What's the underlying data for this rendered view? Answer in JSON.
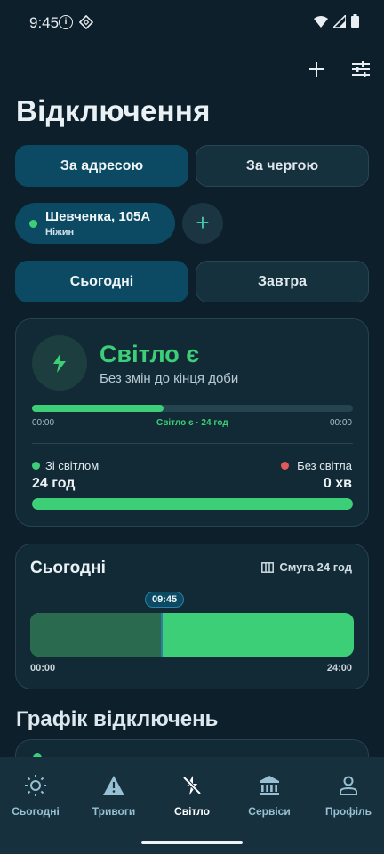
{
  "status_bar": {
    "time": "9:45",
    "info": "i"
  },
  "header": {
    "title": "Відключення"
  },
  "mode_tabs": [
    {
      "label": "За адресою",
      "active": true
    },
    {
      "label": "За чергою",
      "active": false
    }
  ],
  "address": {
    "street": "Шевченка, 105А",
    "city": "Ніжин",
    "add_label": "+"
  },
  "day_tabs": [
    {
      "label": "Сьогодні",
      "active": true
    },
    {
      "label": "Завтра",
      "active": false
    }
  ],
  "status_card": {
    "title": "Світло є",
    "subtitle": "Без змін до кінця доби",
    "progress_fraction": 0.41,
    "progress_start": "00:00",
    "progress_center": "Світло є · 24 год",
    "progress_end": "00:00",
    "with_power_label": "Зі світлом",
    "with_power_value": "24 год",
    "without_power_label": "Без світла",
    "without_power_value": "0 хв",
    "power_share_fraction": 1.0
  },
  "today_card": {
    "title": "Сьогодні",
    "strip_label": "Смуга 24 год",
    "now_time": "09:45",
    "now_fraction": 0.406,
    "start_time": "00:00",
    "end_time": "24:00"
  },
  "schedule_section": {
    "title": "Графік відключень"
  },
  "bottom_nav": [
    {
      "label": "Сьогодні",
      "icon": "sun-icon",
      "active": false
    },
    {
      "label": "Тривоги",
      "icon": "warning-icon",
      "active": false
    },
    {
      "label": "Світло",
      "icon": "bolt-off-icon",
      "active": true
    },
    {
      "label": "Сервіси",
      "icon": "bank-icon",
      "active": false
    },
    {
      "label": "Профіль",
      "icon": "person-icon",
      "active": false
    }
  ],
  "colors": {
    "background": "#0d1f2a",
    "accent_green": "#3ccf78",
    "accent_red": "#e05a5a",
    "active_tab": "#0c4a63",
    "card": "#122a36"
  }
}
